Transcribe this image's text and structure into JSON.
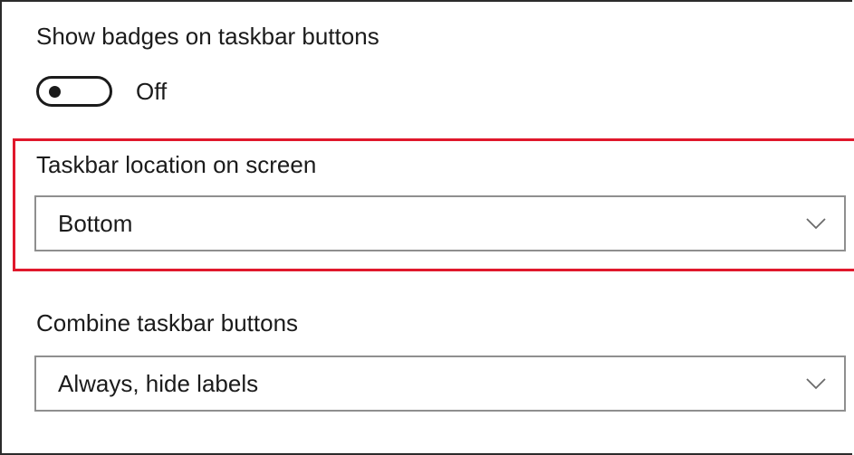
{
  "settings": {
    "badges": {
      "label": "Show badges on taskbar buttons",
      "toggle_state": "Off"
    },
    "location": {
      "label": "Taskbar location on screen",
      "value": "Bottom",
      "icon": "chevron-down-icon"
    },
    "combine": {
      "label": "Combine taskbar buttons",
      "value": "Always, hide labels",
      "icon": "chevron-down-icon"
    }
  },
  "colors": {
    "highlight": "#e0182c",
    "text": "#1b1b1b",
    "dropdown_border": "#8f8f8f"
  }
}
